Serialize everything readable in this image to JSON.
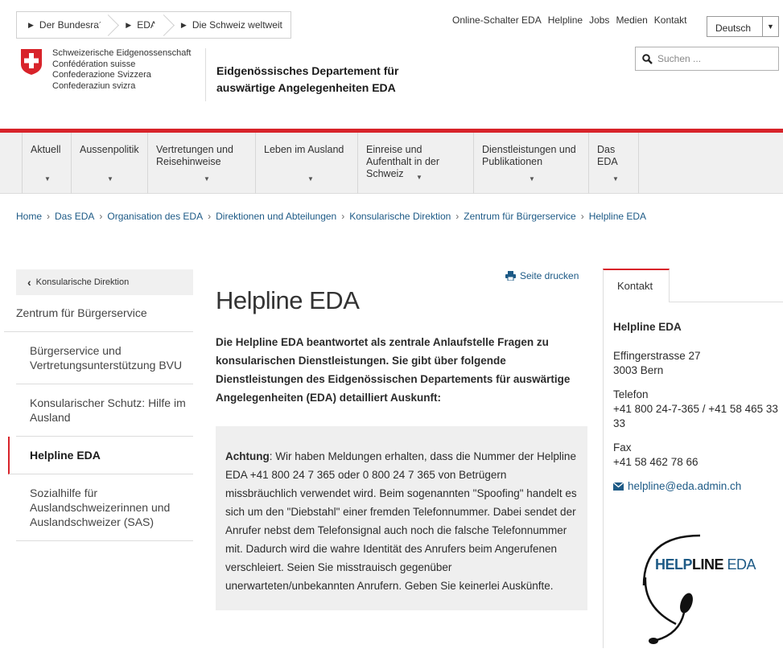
{
  "top_breadcrumbs": [
    "Der Bundesrat",
    "EDA",
    "Die Schweiz weltweit"
  ],
  "meta_links": [
    "Online-Schalter EDA",
    "Helpline",
    "Jobs",
    "Medien",
    "Kontakt"
  ],
  "language": {
    "selected": "Deutsch"
  },
  "search": {
    "placeholder": "Suchen ..."
  },
  "logo": {
    "names": [
      "Schweizerische Eidgenossenschaft",
      "Confédération suisse",
      "Confederazione Svizzera",
      "Confederaziun svizra"
    ],
    "department_line1": "Eidgenössisches Departement für",
    "department_line2": "auswärtige Angelegenheiten EDA"
  },
  "nav": [
    {
      "label": "Aktuell"
    },
    {
      "label": "Aussenpolitik"
    },
    {
      "label": "Vertretungen und Reisehinweise"
    },
    {
      "label": "Leben im Ausland"
    },
    {
      "label": "Einreise und Aufenthalt in der Schweiz"
    },
    {
      "label": "Dienstleistungen und Publikationen"
    },
    {
      "label": "Das EDA"
    }
  ],
  "breadcrumb": [
    "Home",
    "Das EDA",
    "Organisation des EDA",
    "Direktionen und Abteilungen",
    "Konsularische Direktion",
    "Zentrum für Bürgerservice",
    "Helpline EDA"
  ],
  "sidebar": {
    "back_label": "Konsularische Direktion",
    "items": [
      {
        "label": "Zentrum für Bürgerservice"
      },
      {
        "label": "Bürgerservice und Vertretungsunterstützung BVU"
      },
      {
        "label": "Konsularischer Schutz: Hilfe im Ausland"
      },
      {
        "label": "Helpline EDA"
      },
      {
        "label": "Sozialhilfe für Auslandschweizerinnen und Auslandschweizer (SAS)"
      }
    ]
  },
  "content": {
    "print_label": "Seite drucken",
    "title": "Helpline EDA",
    "lead": "Die Helpline EDA beantwortet als zentrale Anlaufstelle Fragen zu konsularischen Dienstleistungen. Sie gibt über folgende Dienstleistungen des Eidgenössischen Departements für auswärtige Angelegenheiten (EDA) detailliert Auskunft:",
    "warning_label": "Achtung",
    "warning_text": ": Wir haben Meldungen erhalten, dass die Nummer der Helpline EDA +41 800 24 7 365 oder 0 800 24 7 365 von Betrügern missbräuchlich verwendet wird. Beim sogenannten \"Spoofing\" handelt es sich um den \"Diebstahl\" einer fremden Telefonnummer. Dabei sendet der Anrufer nebst dem Telefonsignal auch noch die falsche Telefonnummer mit. Dadurch wird die wahre Identität des Anrufers beim Angerufenen verschleiert. Seien Sie misstrauisch gegenüber unerwarteten/unbekannten Anrufern. Geben Sie keinerlei Auskünfte."
  },
  "contact": {
    "tab": "Kontakt",
    "title": "Helpline EDA",
    "street": "Effingerstrasse 27",
    "city": "3003 Bern",
    "phone_label": "Telefon",
    "phone": "+41 800 24-7-365 / +41 58 465 33 33",
    "fax_label": "Fax",
    "fax": "+41 58 462 78 66",
    "email": "helpline@eda.admin.ch",
    "logo_text_1": "HELP",
    "logo_text_2": "LINE",
    "logo_text_3": " EDA"
  },
  "colors": {
    "accent_red": "#d8232a",
    "link_blue": "#1d5a86"
  }
}
